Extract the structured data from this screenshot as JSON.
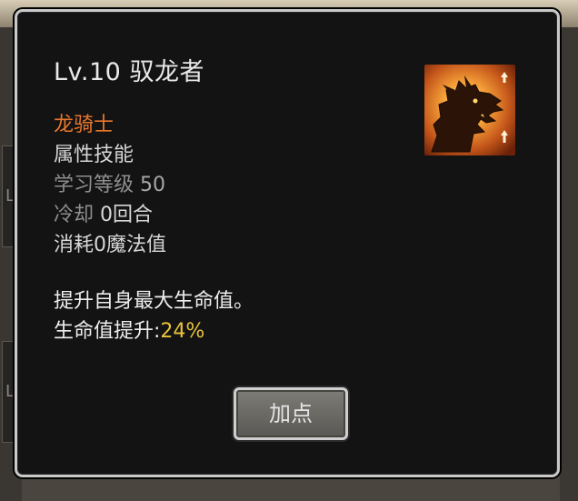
{
  "skill_tooltip": {
    "title": "Lv.10 驭龙者",
    "class_name": "龙骑士",
    "skill_type": "属性技能",
    "learn_level_label": "学习等级",
    "learn_level_value": "50",
    "cooldown_label": "冷却",
    "cooldown_value": "0回合",
    "cost": "消耗0魔法值",
    "description": "提升自身最大生命值。",
    "effect_label": "生命值提升:",
    "effect_value": "24%",
    "icon": "dragon-head-icon",
    "add_point_button": "加点"
  },
  "colors": {
    "class_name": "#e8772c",
    "effect_value": "#e9c23b",
    "panel_background": "#131313",
    "panel_border": "#c9c9c9"
  }
}
